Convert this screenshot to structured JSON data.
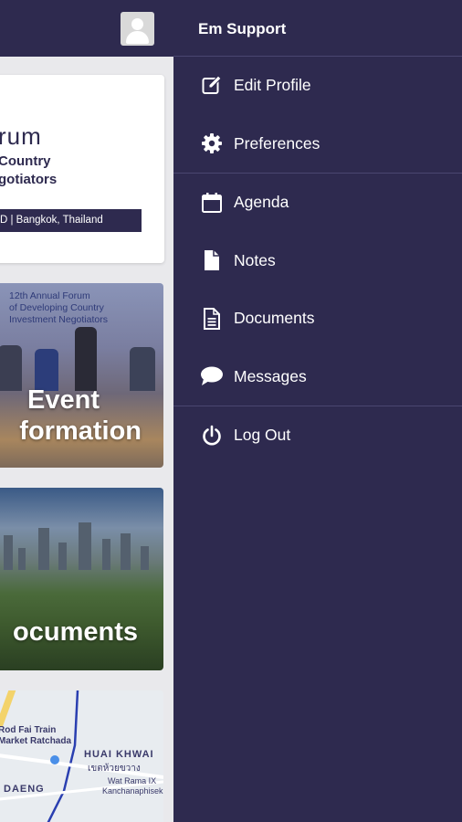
{
  "header": {
    "user_name": "Em Support",
    "avatar_icon": "user-avatar-icon"
  },
  "drawer": {
    "group1": [
      {
        "label": "Edit Profile",
        "icon": "edit-icon"
      },
      {
        "label": "Preferences",
        "icon": "gear-icon"
      }
    ],
    "group2": [
      {
        "label": "Agenda",
        "icon": "calendar-icon"
      },
      {
        "label": "Notes",
        "icon": "note-icon"
      },
      {
        "label": "Documents",
        "icon": "document-icon"
      },
      {
        "label": "Messages",
        "icon": "chat-bubble-icon"
      }
    ],
    "group3": [
      {
        "label": "Log Out",
        "icon": "power-icon"
      }
    ]
  },
  "cards": {
    "forum": {
      "title_fragment": "rum",
      "subtitle_line1": "Country",
      "subtitle_line2": "gotiators",
      "date_location": "D  |  Bangkok, Thailand"
    },
    "event": {
      "banner_line1": "12th Annual Forum",
      "banner_line2": "of Developing Country",
      "banner_line3": "Investment Negotiators",
      "title_line1": "Event",
      "title_line2": "formation"
    },
    "documents": {
      "title": "ocuments"
    },
    "map": {
      "label1": "Rod Fai Train",
      "label2": "Market Ratchada",
      "label3": "HUAI KHWAI",
      "label4": "เขตห้วยขวาง",
      "label5": "Wat Rama IX",
      "label6": "Kanchanaphisek",
      "label7": "DAENG"
    }
  },
  "colors": {
    "drawer_bg": "#2e2a4f",
    "separator": "#4a4670",
    "text": "#ffffff"
  }
}
